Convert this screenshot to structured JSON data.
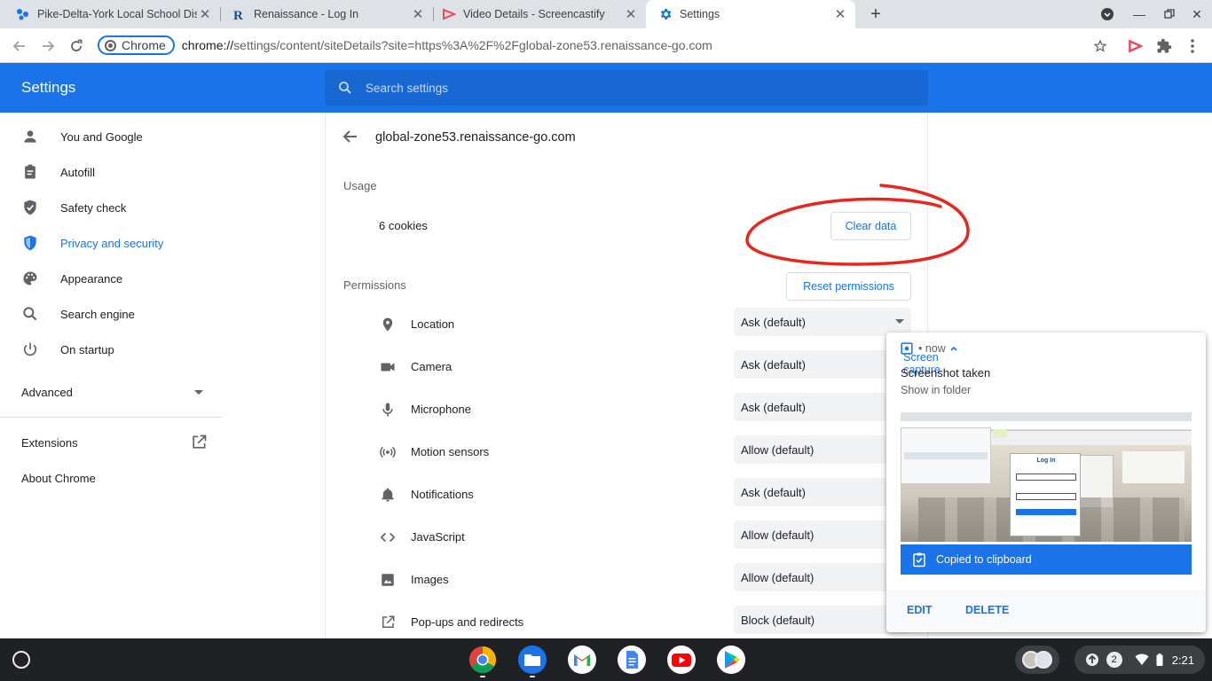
{
  "tabs": [
    {
      "title": "Pike-Delta-York Local School Dis",
      "favicon": "school-favicon"
    },
    {
      "title": "Renaissance - Log In",
      "favicon": "renaissance-favicon"
    },
    {
      "title": "Video Details - Screencastify",
      "favicon": "screencastify-favicon"
    },
    {
      "title": "Settings",
      "favicon": "gear-icon"
    }
  ],
  "omnibox": {
    "chip": "Chrome",
    "url_scheme": "chrome://",
    "url_rest": "settings/content/siteDetails?site=https%3A%2F%2Fglobal-zone53.renaissance-go.com"
  },
  "settings": {
    "title": "Settings",
    "search_placeholder": "Search settings"
  },
  "sidebar": {
    "items": [
      {
        "label": "You and Google",
        "icon": "person-icon"
      },
      {
        "label": "Autofill",
        "icon": "clipboard-icon"
      },
      {
        "label": "Safety check",
        "icon": "shield-check-icon"
      },
      {
        "label": "Privacy and security",
        "icon": "shield-icon"
      },
      {
        "label": "Appearance",
        "icon": "palette-icon"
      },
      {
        "label": "Search engine",
        "icon": "search-icon"
      },
      {
        "label": "On startup",
        "icon": "power-icon"
      }
    ],
    "advanced": "Advanced",
    "extensions": "Extensions",
    "about": "About Chrome"
  },
  "site": {
    "domain": "global-zone53.renaissance-go.com",
    "usage_heading": "Usage",
    "cookies": "6 cookies",
    "clear_data": "Clear data",
    "permissions_heading": "Permissions",
    "reset_permissions": "Reset permissions",
    "permissions": [
      {
        "label": "Location",
        "value": "Ask (default)",
        "icon": "location-icon"
      },
      {
        "label": "Camera",
        "value": "Ask (default)",
        "icon": "camera-icon"
      },
      {
        "label": "Microphone",
        "value": "Ask (default)",
        "icon": "microphone-icon"
      },
      {
        "label": "Motion sensors",
        "value": "Allow (default)",
        "icon": "sensors-icon"
      },
      {
        "label": "Notifications",
        "value": "Ask (default)",
        "icon": "bell-icon"
      },
      {
        "label": "JavaScript",
        "value": "Allow (default)",
        "icon": "code-icon"
      },
      {
        "label": "Images",
        "value": "Allow (default)",
        "icon": "image-icon"
      },
      {
        "label": "Pop-ups and redirects",
        "value": "Block (default)",
        "icon": "open-in-new-icon"
      }
    ]
  },
  "notification": {
    "app": "Screen capture",
    "when": "now",
    "title": "Screenshot taken",
    "subtitle": "Show in folder",
    "copied": "Copied to clipboard",
    "edit": "EDIT",
    "delete": "DELETE",
    "thumb_text": "Log In"
  },
  "shelf": {
    "notification_count": "2",
    "time": "2:21"
  },
  "colors": {
    "accent": "#1a73e8",
    "annotation": "#e8261c"
  }
}
